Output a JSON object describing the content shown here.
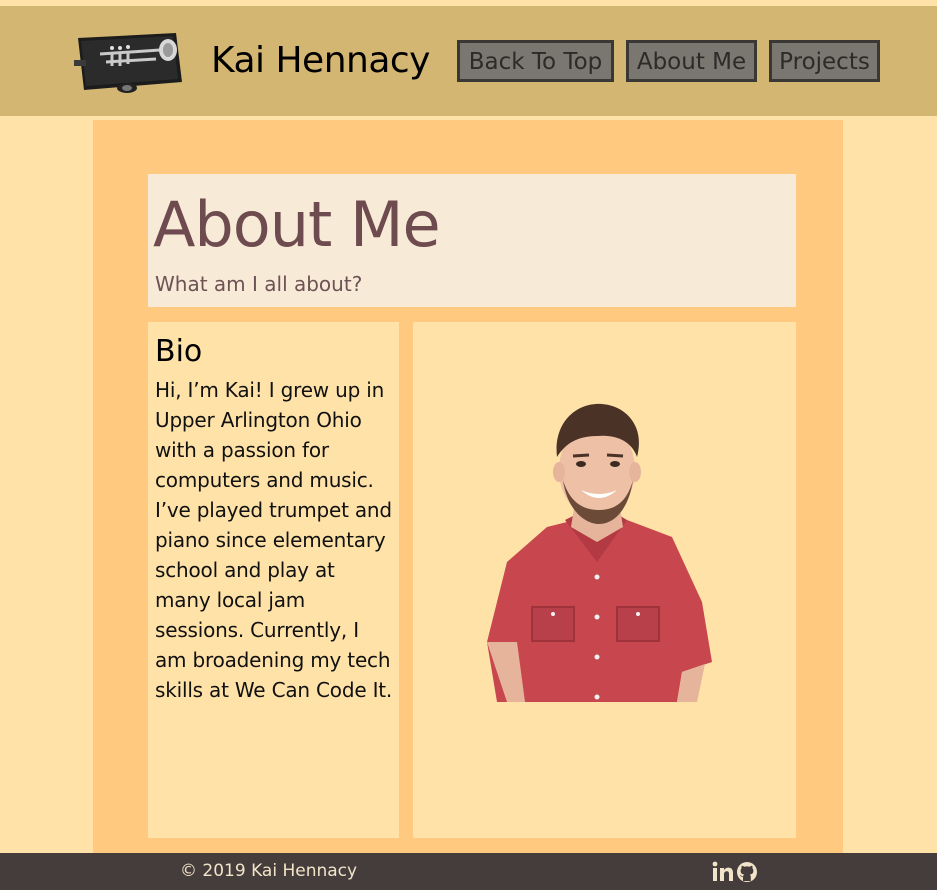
{
  "header": {
    "site_name": "Kai Hennacy",
    "logo_icon": "trumpet-case-icon",
    "nav": [
      {
        "label": "Back To Top"
      },
      {
        "label": "About Me"
      },
      {
        "label": "Projects"
      }
    ]
  },
  "about": {
    "title": "About Me",
    "subtitle": "What am I all about?",
    "bio_heading": "Bio",
    "bio_text": "Hi, I’m Kai! I grew up in Upper Arlington Ohio with a passion for computers and music. I’ve played trumpet and piano since elementary school and play at many local jam sessions. Currently, I am broadening my tech skills at We Can Code It.",
    "photo_icon": "portrait-photo"
  },
  "footer": {
    "copyright": "© 2019 Kai Hennacy",
    "social_icons": [
      "linkedin-icon",
      "github-icon"
    ]
  },
  "colors": {
    "header_bg": "#d4b673",
    "page_bg": "#ffe2a8",
    "main_bg": "#ffca80",
    "title_box_bg": "#f7ead7",
    "title_color": "#6e4b4e",
    "nav_button_bg": "#7a7670",
    "footer_bg": "#453c3c",
    "shirt_color": "#c8464e"
  }
}
